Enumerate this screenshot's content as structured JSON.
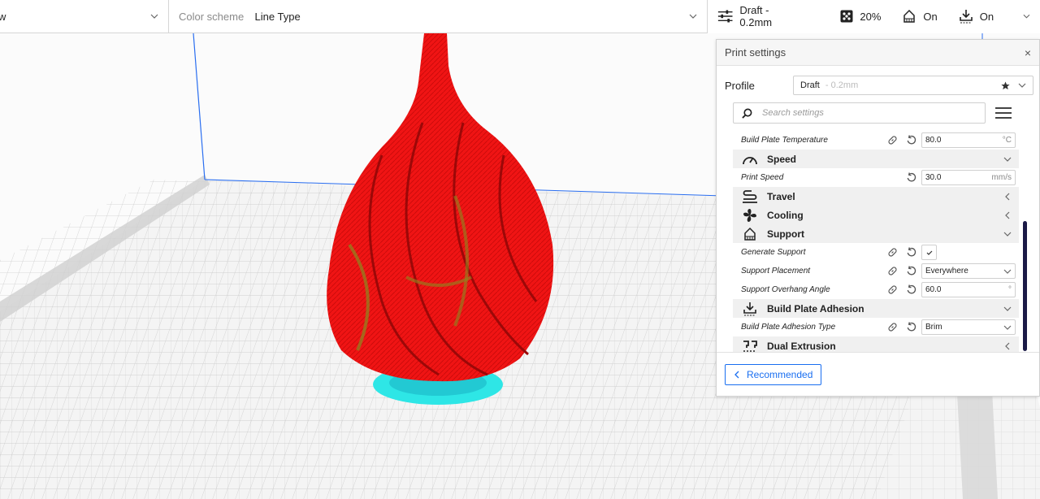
{
  "topbar": {
    "view_value_cut": "w",
    "color_scheme_label": "Color scheme",
    "color_scheme_value": "Line Type",
    "profile_quick": "Draft - 0.2mm",
    "infill_value": "20%",
    "support_value": "On",
    "adhesion_value": "On"
  },
  "panel": {
    "title": "Print settings",
    "close": "×",
    "profile_label": "Profile",
    "profile_name": "Draft",
    "profile_sub": "- 0.2mm",
    "search_placeholder": "Search settings",
    "footer_button": "Recommended"
  },
  "settings": {
    "build_plate_temp": {
      "label": "Build Plate Temperature",
      "value": "80.0",
      "unit": "°C"
    },
    "speed": {
      "category": "Speed"
    },
    "print_speed": {
      "label": "Print Speed",
      "value": "30.0",
      "unit": "mm/s"
    },
    "travel": {
      "category": "Travel"
    },
    "cooling": {
      "category": "Cooling"
    },
    "support": {
      "category": "Support"
    },
    "generate_support": {
      "label": "Generate Support"
    },
    "support_placement": {
      "label": "Support Placement",
      "value": "Everywhere"
    },
    "support_overhang": {
      "label": "Support Overhang Angle",
      "value": "60.0",
      "unit": "°"
    },
    "adhesion": {
      "category": "Build Plate Adhesion"
    },
    "adhesion_type": {
      "label": "Build Plate Adhesion Type",
      "value": "Brim"
    },
    "dual": {
      "category": "Dual Extrusion"
    }
  },
  "colors": {
    "accent": "#196ef0",
    "model": "#f01010",
    "support_cyan": "#2ee6e6",
    "grid": "#c8c8c8"
  }
}
